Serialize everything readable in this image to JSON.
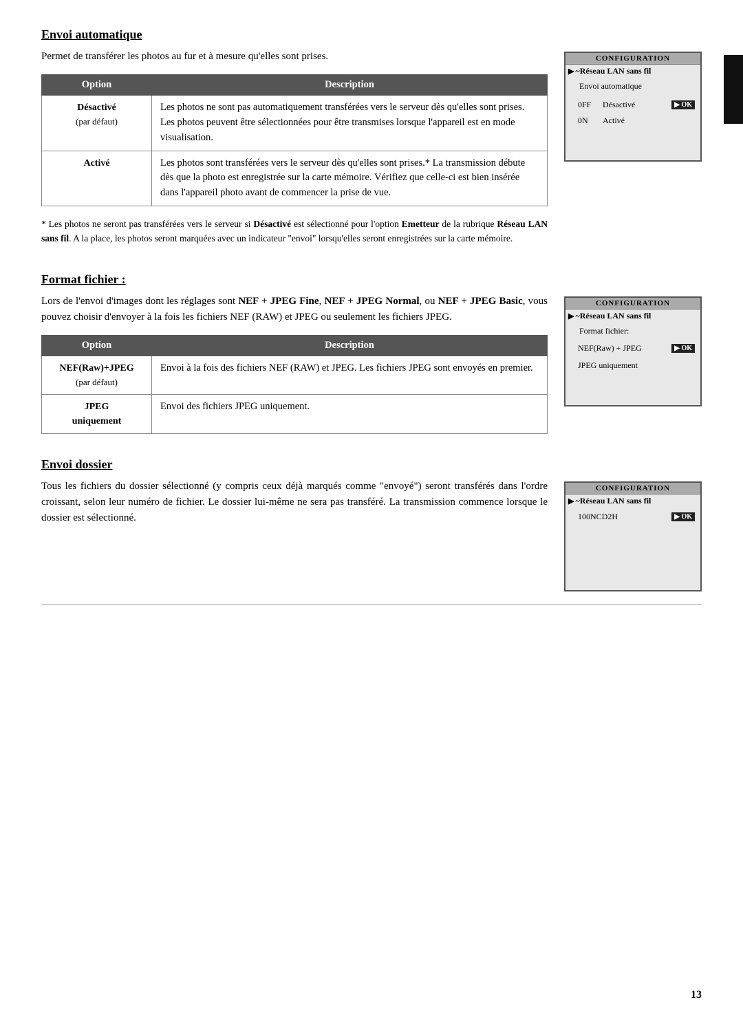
{
  "page": {
    "number": "13"
  },
  "sections": [
    {
      "id": "envoi-automatique",
      "title": "Envoi automatique",
      "text": "Permet de transférer les photos au fur et à mesure qu'elles sont prises.",
      "camera_screen": {
        "title": "Configuration",
        "wifi_label": "Réseau LAN sans fil",
        "menu_label": "Envoi automatique",
        "options": [
          {
            "key": "0FF",
            "value": "Désactivé",
            "selected": true
          },
          {
            "key": "0N",
            "value": "Activé",
            "selected": false
          }
        ]
      },
      "table": {
        "col1": "Option",
        "col2": "Description",
        "rows": [
          {
            "option": "Désactivé",
            "sub": "(par défaut)",
            "description": "Les photos ne sont pas automatiquement transférées vers le serveur dès qu'elles sont prises. Les photos peuvent être sélectionnées pour être transmises lorsque l'appareil est en mode visualisation."
          },
          {
            "option": "Activé",
            "sub": "",
            "description": "Les photos sont transférées vers le serveur dès qu'elles sont prises.* La transmission débute dès que la photo est enregistrée sur la carte mémoire. Vérifiez que celle-ci est bien insérée dans l'appareil photo avant de commencer la prise de vue."
          }
        ]
      },
      "footnote": "* Les photos ne seront pas transférées vers le serveur si Désactivé est sélectionné pour l'option Emetteur de la rubrique Réseau LAN sans fil. A la place, les photos seront marquées avec un indicateur \"envoi\" lorsqu'elles seront enregistrées sur la carte mémoire."
    },
    {
      "id": "format-fichier",
      "title": "Format fichier :",
      "text": "Lors de l'envoi d'images dont les réglages sont NEF + JPEG Fine, NEF + JPEG Normal, ou NEF + JPEG Basic, vous pouvez choisir d'envoyer à la fois les fichiers NEF (RAW) et JPEG ou seulement les fichiers JPEG.",
      "camera_screen": {
        "title": "Configuration",
        "wifi_label": "Réseau LAN sans fil",
        "menu_label": "Format fichier:",
        "options": [
          {
            "key": "",
            "value": "NEF(Raw) + JPEG",
            "selected": true
          },
          {
            "key": "",
            "value": "JPEG uniquement",
            "selected": false
          }
        ]
      },
      "table": {
        "col1": "Option",
        "col2": "Description",
        "rows": [
          {
            "option": "NEF(Raw)+JPEG",
            "sub": "(par défaut)",
            "description": "Envoi à la fois des fichiers NEF (RAW) et JPEG. Les fichiers JPEG sont envoyés en premier."
          },
          {
            "option": "JPEG\nuniquement",
            "sub": "",
            "description": "Envoi des fichiers JPEG uniquement."
          }
        ]
      }
    },
    {
      "id": "envoi-dossier",
      "title": "Envoi dossier",
      "text": "Tous les fichiers du dossier sélectionné (y compris ceux déjà marqués comme \"envoyé\") seront transférés dans l'ordre croissant, selon leur numéro de fichier. Le dossier lui-même ne sera pas transféré. La transmission commence lorsque le dossier est sélectionné.",
      "camera_screen": {
        "title": "Configuration",
        "wifi_label": "Réseau LAN sans fil",
        "menu_label": "",
        "options": [
          {
            "key": "",
            "value": "100NCD2H",
            "selected": true
          }
        ]
      }
    }
  ]
}
